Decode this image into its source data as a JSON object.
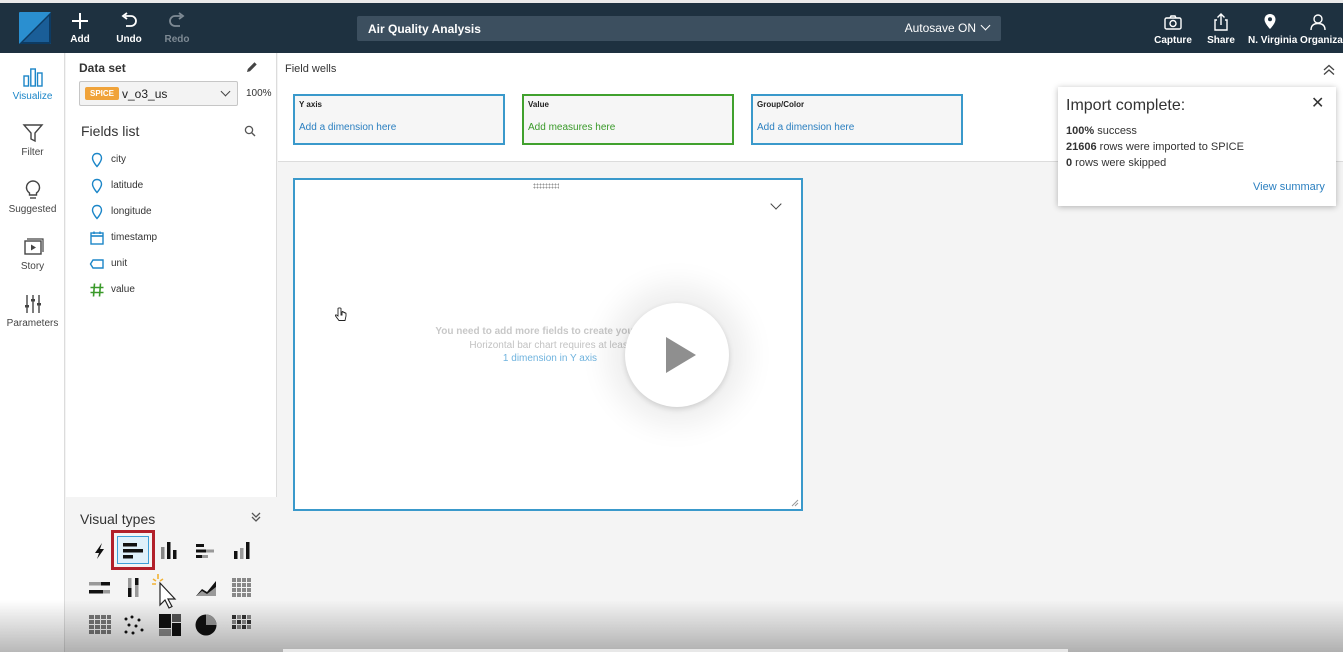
{
  "topbar": {
    "add_label": "Add",
    "undo_label": "Undo",
    "redo_label": "Redo",
    "document_title": "Air Quality Analysis",
    "autosave_label": "Autosave ON",
    "capture_label": "Capture",
    "share_label": "Share",
    "account_label": "N. Virginia Organiza..."
  },
  "rail": {
    "items": [
      {
        "label": "Visualize",
        "icon": "bar-chart-icon",
        "active": true
      },
      {
        "label": "Filter",
        "icon": "funnel-icon",
        "active": false
      },
      {
        "label": "Suggested",
        "icon": "lightbulb-icon",
        "active": false
      },
      {
        "label": "Story",
        "icon": "story-play-icon",
        "active": false
      },
      {
        "label": "Parameters",
        "icon": "sliders-icon",
        "active": false
      }
    ]
  },
  "dataset": {
    "label": "Data set",
    "badge": "SPICE",
    "name": "v_o3_us",
    "percent": "100%"
  },
  "fields": {
    "title": "Fields list",
    "items": [
      {
        "name": "city",
        "icon": "geo-pin-icon"
      },
      {
        "name": "latitude",
        "icon": "geo-pin-icon"
      },
      {
        "name": "longitude",
        "icon": "geo-pin-icon"
      },
      {
        "name": "timestamp",
        "icon": "calendar-icon"
      },
      {
        "name": "unit",
        "icon": "string-tag-icon"
      },
      {
        "name": "value",
        "icon": "hash-icon"
      }
    ]
  },
  "visual_types": {
    "title": "Visual types",
    "selected": "horizontal-bar-chart"
  },
  "field_wells": {
    "title": "Field wells",
    "wells": [
      {
        "title": "Y axis",
        "placeholder": "Add a dimension here"
      },
      {
        "title": "Value",
        "placeholder": "Add measures here"
      },
      {
        "title": "Group/Color",
        "placeholder": "Add a dimension here"
      }
    ]
  },
  "visual": {
    "message_title": "You need to add more fields to create your chart",
    "message_requirement": "Horizontal bar chart requires at least",
    "message_link": "1 dimension in Y axis"
  },
  "toast": {
    "title": "Import complete:",
    "success_pct": "100%",
    "success_text": " success",
    "rows_imported": "21606",
    "rows_imported_text": " rows were imported to SPICE",
    "rows_skipped": "0",
    "rows_skipped_text": " rows were skipped",
    "link": "View summary"
  },
  "colors": {
    "topbar_bg": "#1e3140",
    "accent_blue": "#3a99cb",
    "measure_green": "#41a12e",
    "spice_orange": "#f0a33a",
    "selection_red": "#b2202a"
  }
}
